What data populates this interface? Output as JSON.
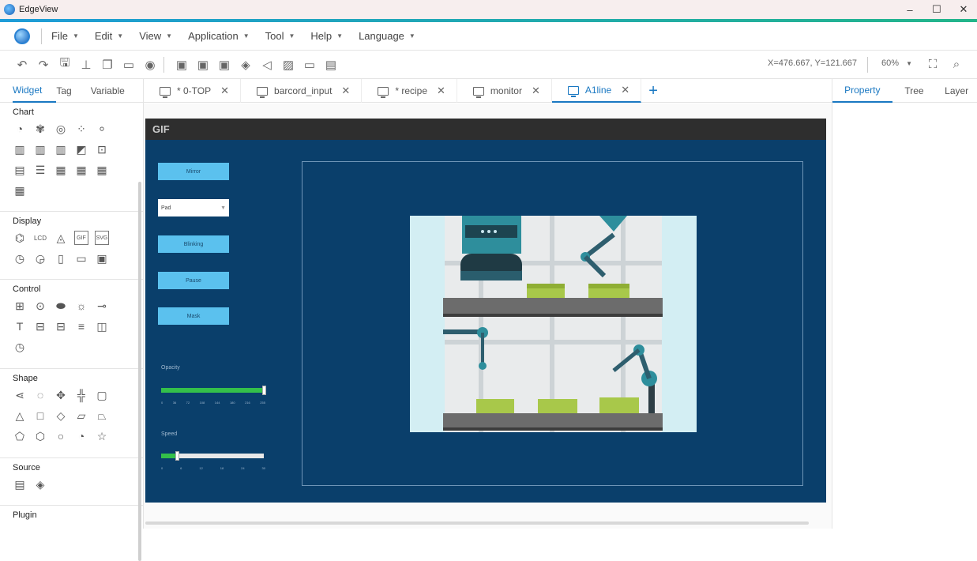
{
  "window": {
    "title": "EdgeView",
    "minimize": "–",
    "maximize": "☐",
    "close": "✕"
  },
  "menu": {
    "items": [
      {
        "label": "File"
      },
      {
        "label": "Edit"
      },
      {
        "label": "View"
      },
      {
        "label": "Application"
      },
      {
        "label": "Tool"
      },
      {
        "label": "Help"
      },
      {
        "label": "Language"
      }
    ]
  },
  "toolbar": {
    "coordinates": "X=476.667, Y=121.667",
    "zoom": "60%"
  },
  "left_panel": {
    "tabs": [
      "Widget",
      "Tag",
      "Variable"
    ],
    "sections": [
      "Chart",
      "Display",
      "Control",
      "Shape",
      "Source",
      "Plugin"
    ],
    "display_lcd": "LCD"
  },
  "doc_tabs": [
    {
      "label": "* 0-TOP"
    },
    {
      "label": "barcord_input"
    },
    {
      "label": "* recipe"
    },
    {
      "label": "monitor"
    },
    {
      "label": "A1line"
    }
  ],
  "right_panel": {
    "tabs": [
      "Property",
      "Tree",
      "Layer"
    ]
  },
  "screen": {
    "header": "GIF",
    "buttons": [
      "Mirror",
      "Blinking",
      "Pause",
      "Mask"
    ],
    "select_value": "Pad",
    "opacity_label": "Opacity",
    "opacity_value": 1.0,
    "opacity_ticks": [
      "0",
      "36",
      "72",
      "108",
      "144",
      "180",
      "216",
      "255"
    ],
    "speed_label": "Speed",
    "speed_value": 0.15,
    "speed_ticks": [
      "0",
      "6",
      "12",
      "18",
      "24",
      "30"
    ]
  }
}
